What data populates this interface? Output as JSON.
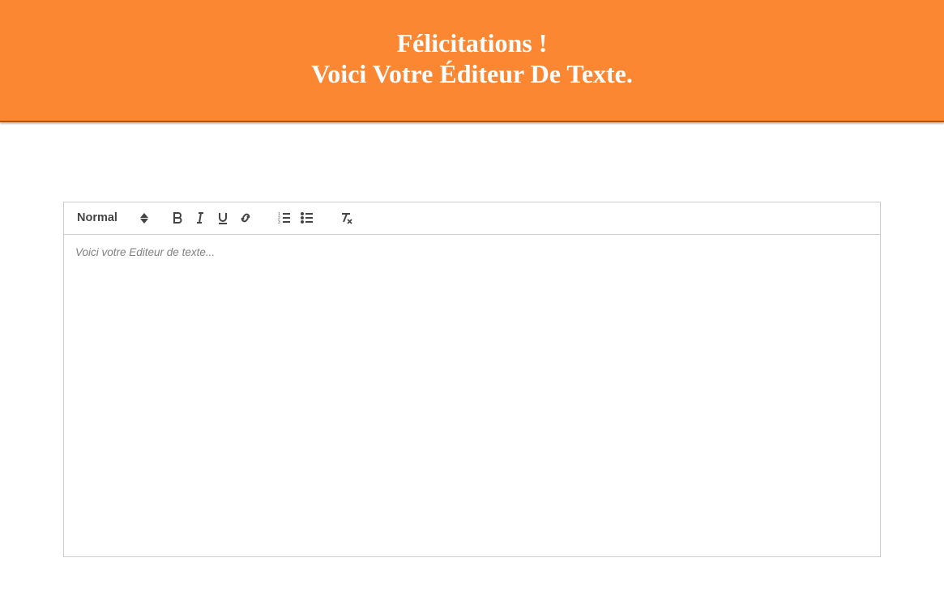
{
  "header": {
    "line1": "Félicitations !",
    "line2": "Voici Votre Éditeur De Texte."
  },
  "toolbar": {
    "header_select": "Normal"
  },
  "editor": {
    "placeholder": "Voici votre Editeur de texte..."
  }
}
